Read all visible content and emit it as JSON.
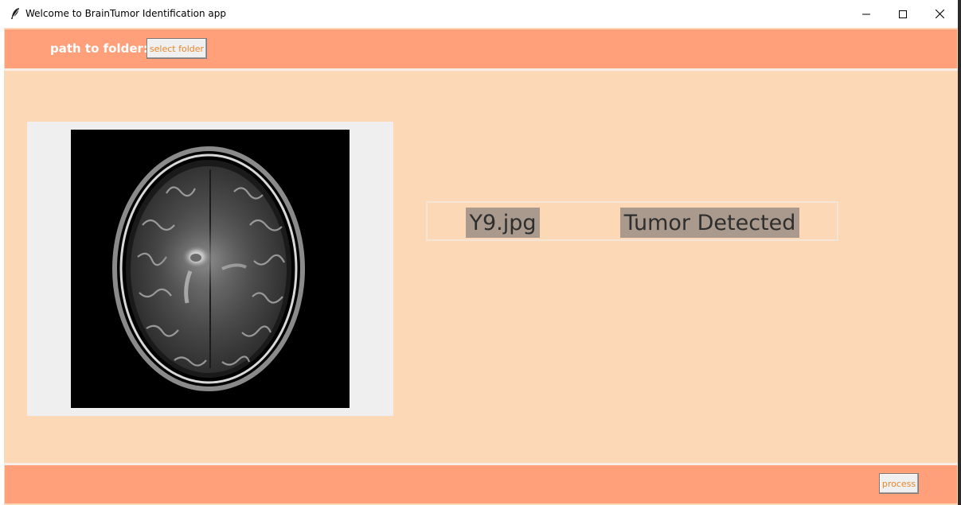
{
  "window": {
    "title": "Welcome to BrainTumor Identification app"
  },
  "toolbar": {
    "path_label": "path to folder:",
    "select_folder_label": "select folder"
  },
  "result": {
    "filename": "Y9.jpg",
    "status": "Tumor Detected"
  },
  "footer": {
    "process_label": "process"
  },
  "colors": {
    "client_bg": "#fdd8b6",
    "bar_bg": "#ffa07a",
    "button_text": "#e8862a",
    "result_cell_bg": "#a99a8d"
  },
  "icons": {
    "app": "feather-icon",
    "minimize": "minimize-icon",
    "maximize": "maximize-icon",
    "close": "close-icon"
  }
}
